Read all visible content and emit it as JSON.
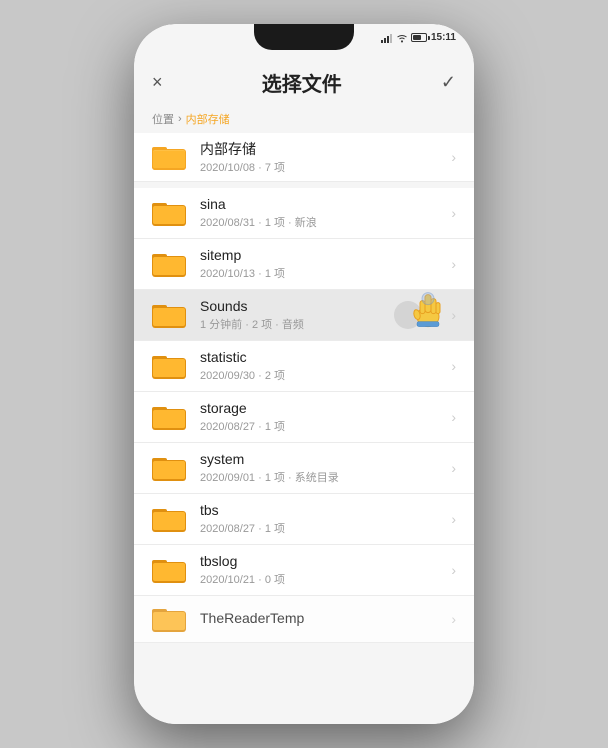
{
  "phone": {
    "status": {
      "time": "15:11",
      "signal": "强",
      "wifi": "wifi",
      "battery_level": "60"
    }
  },
  "header": {
    "title": "选择文件",
    "close_label": "×",
    "check_label": "✓"
  },
  "breadcrumb": {
    "label": "位置",
    "separator": "›",
    "current": "内部存储"
  },
  "top_folder": {
    "name": "内部存储",
    "meta": "2020/10/08 · 7 项"
  },
  "folders": [
    {
      "name": "sina",
      "meta": "2020/08/31 · 1 项 · 新浪",
      "highlighted": false
    },
    {
      "name": "sitemp",
      "meta": "2020/10/13 · 1 项",
      "highlighted": false
    },
    {
      "name": "Sounds",
      "meta": "1 分钟前 · 2 项 · 音频",
      "highlighted": true
    },
    {
      "name": "statistic",
      "meta": "2020/09/30 · 2 项",
      "highlighted": false
    },
    {
      "name": "storage",
      "meta": "2020/08/27 · 1 项",
      "highlighted": false
    },
    {
      "name": "system",
      "meta": "2020/09/01 · 1 项 · 系统目录",
      "highlighted": false
    },
    {
      "name": "tbs",
      "meta": "2020/08/27 · 1 项",
      "highlighted": false
    },
    {
      "name": "tbslog",
      "meta": "2020/10/21 · 0 项",
      "highlighted": false
    },
    {
      "name": "TheReaderTemp",
      "meta": "",
      "highlighted": false
    }
  ],
  "icons": {
    "folder_color": "#F5A623",
    "folder_dark": "#E09010"
  }
}
